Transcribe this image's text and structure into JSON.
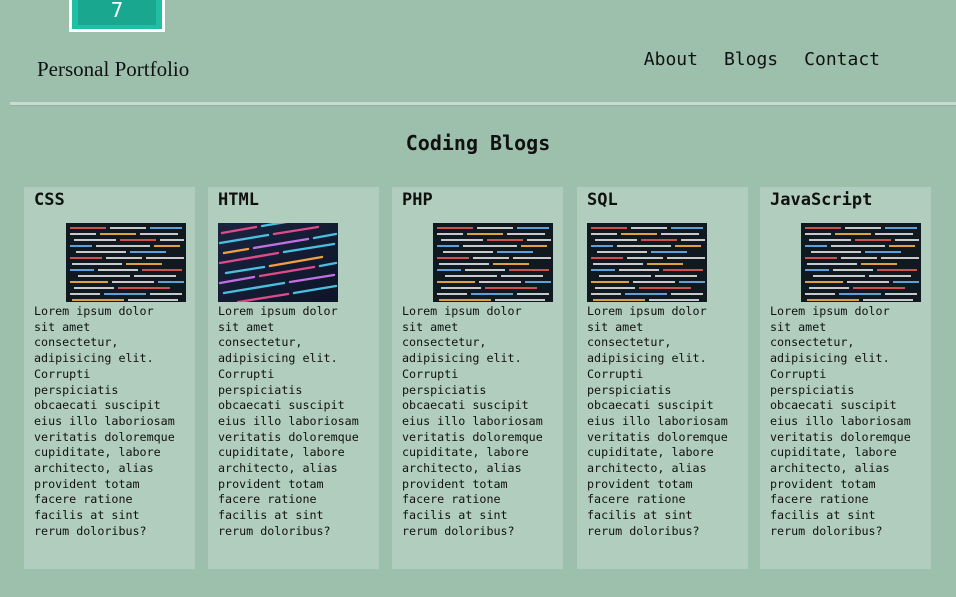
{
  "logo": {
    "glyph": "7"
  },
  "brand": {
    "title": "Personal Portfolio"
  },
  "nav": {
    "items": [
      "About",
      "Blogs",
      "Contact"
    ]
  },
  "section": {
    "title": "Coding Blogs"
  },
  "cards": [
    {
      "title": "CSS",
      "text": "Lorem ipsum dolor\nsit amet\nconsectetur,\nadipisicing elit.\nCorrupti\nperspiciatis\nobcaecati suscipit\neius illo laboriosam\nveritatis doloremque\ncupiditate, labore\narchitecto, alias\nprovident totam\nfacere ratione\nfacilis at sint\nrerum doloribus?"
    },
    {
      "title": "HTML",
      "text": "Lorem ipsum dolor\nsit amet\nconsectetur,\nadipisicing elit.\nCorrupti\nperspiciatis\nobcaecati suscipit\neius illo laboriosam\nveritatis doloremque\ncupiditate, labore\narchitecto, alias\nprovident totam\nfacere ratione\nfacilis at sint\nrerum doloribus?"
    },
    {
      "title": "PHP",
      "text": "Lorem ipsum dolor\nsit amet\nconsectetur,\nadipisicing elit.\nCorrupti\nperspiciatis\nobcaecati suscipit\neius illo laboriosam\nveritatis doloremque\ncupiditate, labore\narchitecto, alias\nprovident totam\nfacere ratione\nfacilis at sint\nrerum doloribus?"
    },
    {
      "title": "SQL",
      "text": "Lorem ipsum dolor\nsit amet\nconsectetur,\nadipisicing elit.\nCorrupti\nperspiciatis\nobcaecati suscipit\neius illo laboriosam\nveritatis doloremque\ncupiditate, labore\narchitecto, alias\nprovident totam\nfacere ratione\nfacilis at sint\nrerum doloribus?"
    },
    {
      "title": "JavaScript",
      "text": "Lorem ipsum dolor\nsit amet\nconsectetur,\nadipisicing elit.\nCorrupti\nperspiciatis\nobcaecati suscipit\neius illo laboriosam\nveritatis doloremque\ncupiditate, labore\narchitecto, alias\nprovident totam\nfacere ratione\nfacilis at sint\nrerum doloribus?"
    }
  ],
  "colors": {
    "page_bg": "#9dc0ad",
    "card_bg": "#b1cdbd",
    "logo_bg": "#1fbfa5"
  }
}
